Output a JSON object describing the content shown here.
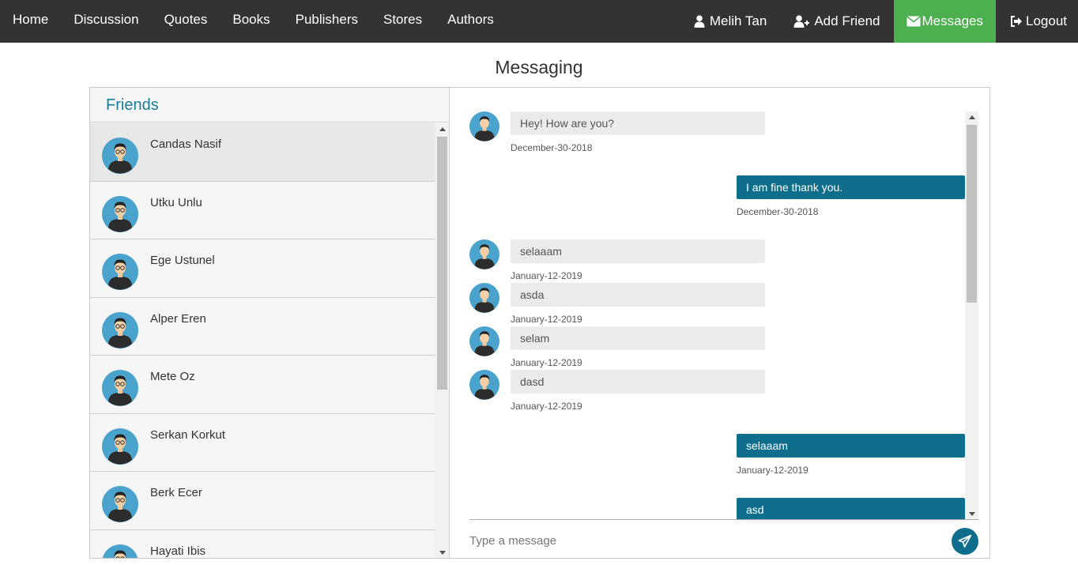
{
  "nav": {
    "left_items": [
      "Home",
      "Discussion",
      "Quotes",
      "Books",
      "Publishers",
      "Stores",
      "Authors"
    ],
    "user_label": "Melih Tan",
    "add_friend_label": "Add Friend",
    "messages_label": "Messages",
    "logout_label": "Logout"
  },
  "page": {
    "title": "Messaging"
  },
  "friends": {
    "header": "Friends",
    "items": [
      {
        "name": "Candas Nasif"
      },
      {
        "name": "Utku Unlu"
      },
      {
        "name": "Ege Ustunel"
      },
      {
        "name": "Alper Eren"
      },
      {
        "name": "Mete Oz"
      },
      {
        "name": "Serkan Korkut"
      },
      {
        "name": "Berk Ecer"
      },
      {
        "name": "Hayati Ibis"
      }
    ]
  },
  "chat": {
    "messages": [
      {
        "direction": "in",
        "text": "Hey! How are you?",
        "date": "December-30-2018"
      },
      {
        "direction": "out",
        "text": "I am fine thank you.",
        "date": "December-30-2018"
      },
      {
        "direction": "in",
        "text": "selaaam",
        "date": "January-12-2019"
      },
      {
        "direction": "in",
        "text": "asda",
        "date": "January-12-2019"
      },
      {
        "direction": "in",
        "text": "selam",
        "date": "January-12-2019"
      },
      {
        "direction": "in",
        "text": "dasd",
        "date": "January-12-2019"
      },
      {
        "direction": "out",
        "text": "selaaam",
        "date": "January-12-2019"
      },
      {
        "direction": "out",
        "text": "asd",
        "date": ""
      }
    ],
    "input_placeholder": "Type a message",
    "input_value": ""
  },
  "colors": {
    "navbar_bg": "#333333",
    "active_tab": "#4CAF50",
    "accent": "#0e6e8c",
    "friends_header": "#1a7b96",
    "incoming_bubble": "#ebebeb"
  },
  "icons": {
    "user": "user-icon",
    "add_friend": "user-plus-icon",
    "messages": "envelope-icon",
    "logout": "sign-out-icon",
    "send": "paper-plane-icon"
  }
}
